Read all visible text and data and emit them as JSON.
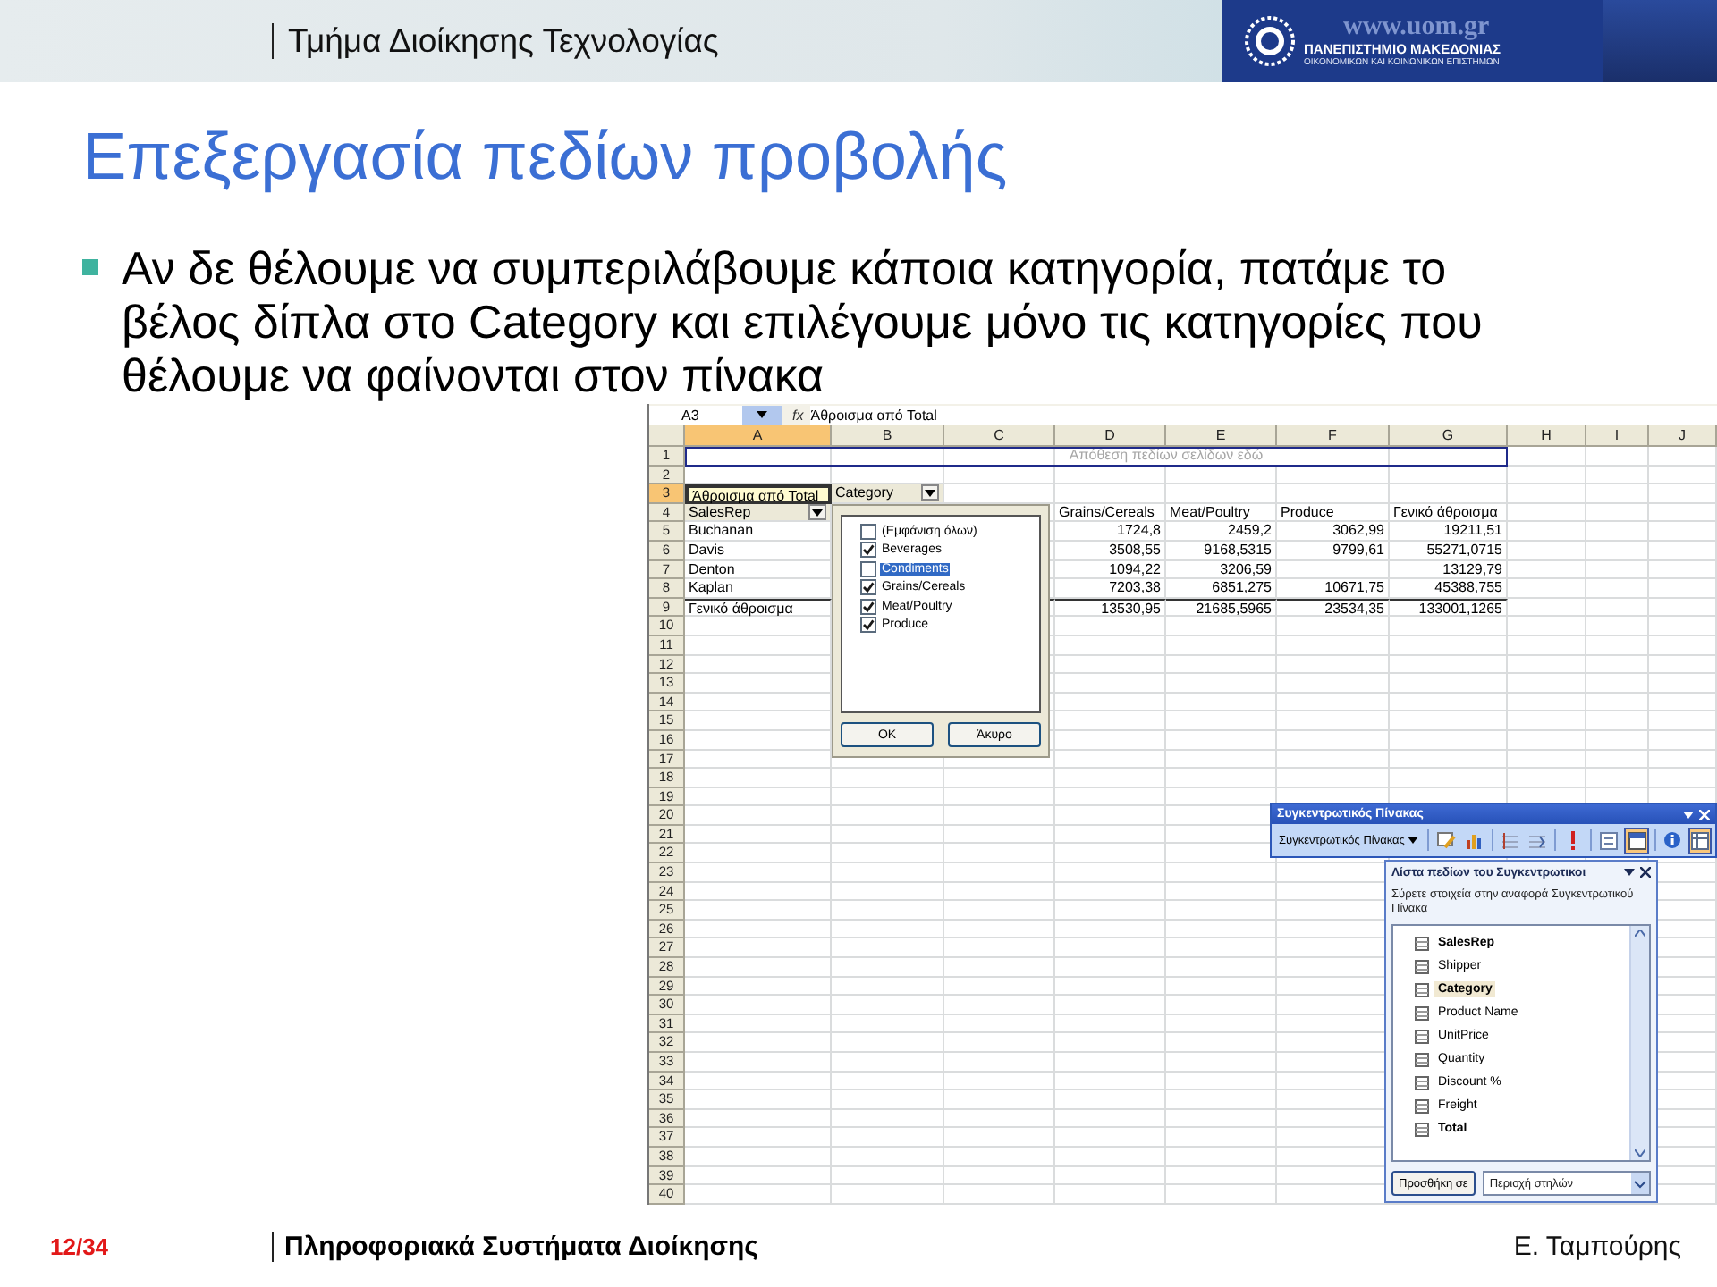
{
  "header": {
    "department": "Τμήμα Διοίκησης Τεχνολογίας",
    "logo": {
      "url": "www.uom.gr",
      "name": "ΠΑΝΕΠΙΣΤΗΜΙΟ ΜΑΚΕΔΟΝΙΑΣ",
      "subtitle": "ΟΙΚΟΝΟΜΙΚΩΝ ΚΑΙ ΚΟΙΝΩΝΙΚΩΝ ΕΠΙΣΤΗΜΩΝ"
    }
  },
  "title": "Επεξεργασία πεδίων προβολής",
  "bullets": [
    "Αν δε θέλουμε να συμπεριλάβουμε κάποια κατηγορία, πατάμε το βέλος δίπλα στο Category και επιλέγουμε μόνο τις κατηγορίες που θέλουμε να φαίνονται στον πίνακα"
  ],
  "spreadsheet": {
    "name_box": "A3",
    "function_label": "fx",
    "formula": "Άθροισμα από Total",
    "columns": [
      {
        "label": "A",
        "selected": true
      },
      {
        "label": "B",
        "selected": false
      },
      {
        "label": "C",
        "selected": false
      },
      {
        "label": "D",
        "selected": false
      },
      {
        "label": "E",
        "selected": false
      },
      {
        "label": "F",
        "selected": false
      },
      {
        "label": "G",
        "selected": false
      },
      {
        "label": "H",
        "selected": false
      },
      {
        "label": "I",
        "selected": false
      },
      {
        "label": "J",
        "selected": false
      }
    ],
    "rows": [
      {
        "number": "1",
        "selected": false,
        "cells": [
          {
            "text": "",
            "kind": "label"
          },
          {
            "text": "",
            "kind": "label"
          },
          {
            "text": "",
            "kind": "label"
          },
          {
            "text": "Απόθεση πεδίων σελίδων εδώ",
            "kind": "drop_zone"
          }
        ]
      },
      {
        "number": "2",
        "selected": false,
        "cells": []
      },
      {
        "number": "3",
        "selected": true,
        "cells": [
          {
            "text": "Άθροισμα από Total",
            "kind": "data_field"
          },
          {
            "text": "Category",
            "kind": "field_button"
          }
        ]
      },
      {
        "number": "4",
        "selected": false,
        "cells": [
          {
            "text": "SalesRep",
            "kind": "field_button"
          },
          {
            "text": "",
            "kind": "label"
          },
          {
            "text": "",
            "kind": "label"
          },
          {
            "text": "Grains/Cereals",
            "kind": "label"
          },
          {
            "text": "Meat/Poultry",
            "kind": "label"
          },
          {
            "text": "Produce",
            "kind": "label"
          },
          {
            "text": "Γενικό άθροισμα",
            "kind": "label"
          }
        ]
      },
      {
        "number": "5",
        "selected": false,
        "cells": [
          {
            "text": "Buchanan",
            "kind": "label"
          },
          {
            "text": "",
            "kind": "number"
          },
          {
            "text": "",
            "kind": "number"
          },
          {
            "text": "1724,8",
            "kind": "number"
          },
          {
            "text": "2459,2",
            "kind": "number"
          },
          {
            "text": "3062,99",
            "kind": "number"
          },
          {
            "text": "19211,51",
            "kind": "number"
          }
        ]
      },
      {
        "number": "6",
        "selected": false,
        "cells": [
          {
            "text": "Davis",
            "kind": "label"
          },
          {
            "text": "",
            "kind": "number"
          },
          {
            "text": "",
            "kind": "number"
          },
          {
            "text": "3508,55",
            "kind": "number"
          },
          {
            "text": "9168,5315",
            "kind": "number"
          },
          {
            "text": "9799,61",
            "kind": "number"
          },
          {
            "text": "55271,0715",
            "kind": "number"
          }
        ]
      },
      {
        "number": "7",
        "selected": false,
        "cells": [
          {
            "text": "Denton",
            "kind": "label"
          },
          {
            "text": "",
            "kind": "number"
          },
          {
            "text": "",
            "kind": "number"
          },
          {
            "text": "1094,22",
            "kind": "number"
          },
          {
            "text": "3206,59",
            "kind": "number"
          },
          {
            "text": "",
            "kind": "number"
          },
          {
            "text": "13129,79",
            "kind": "number"
          }
        ]
      },
      {
        "number": "8",
        "selected": false,
        "cells": [
          {
            "text": "Kaplan",
            "kind": "label"
          },
          {
            "text": "",
            "kind": "number"
          },
          {
            "text": "",
            "kind": "number"
          },
          {
            "text": "7203,38",
            "kind": "number"
          },
          {
            "text": "6851,275",
            "kind": "number"
          },
          {
            "text": "10671,75",
            "kind": "number"
          },
          {
            "text": "45388,755",
            "kind": "number"
          }
        ]
      },
      {
        "number": "9",
        "selected": false,
        "cells": [
          {
            "text": "Γενικό άθροισμα",
            "kind": "total_label"
          },
          {
            "text": "",
            "kind": "total_number"
          },
          {
            "text": "",
            "kind": "total_number"
          },
          {
            "text": "13530,95",
            "kind": "total_number"
          },
          {
            "text": "21685,5965",
            "kind": "total_number"
          },
          {
            "text": "23534,35",
            "kind": "total_number"
          },
          {
            "text": "133001,1265",
            "kind": "total_number"
          }
        ]
      },
      {
        "number": "10",
        "selected": false,
        "cells": []
      },
      {
        "number": "11",
        "selected": false,
        "cells": []
      },
      {
        "number": "12",
        "selected": false,
        "cells": []
      },
      {
        "number": "13",
        "selected": false,
        "cells": []
      },
      {
        "number": "14",
        "selected": false,
        "cells": []
      },
      {
        "number": "15",
        "selected": false,
        "cells": []
      },
      {
        "number": "16",
        "selected": false,
        "cells": []
      },
      {
        "number": "17",
        "selected": false,
        "cells": []
      },
      {
        "number": "18",
        "selected": false,
        "cells": []
      },
      {
        "number": "19",
        "selected": false,
        "cells": []
      },
      {
        "number": "20",
        "selected": false,
        "cells": []
      },
      {
        "number": "21",
        "selected": false,
        "cells": []
      },
      {
        "number": "22",
        "selected": false,
        "cells": []
      },
      {
        "number": "23",
        "selected": false,
        "cells": []
      },
      {
        "number": "24",
        "selected": false,
        "cells": []
      },
      {
        "number": "25",
        "selected": false,
        "cells": []
      },
      {
        "number": "26",
        "selected": false,
        "cells": []
      },
      {
        "number": "27",
        "selected": false,
        "cells": []
      },
      {
        "number": "28",
        "selected": false,
        "cells": []
      },
      {
        "number": "29",
        "selected": false,
        "cells": []
      },
      {
        "number": "30",
        "selected": false,
        "cells": []
      },
      {
        "number": "31",
        "selected": false,
        "cells": []
      },
      {
        "number": "32",
        "selected": false,
        "cells": []
      },
      {
        "number": "33",
        "selected": false,
        "cells": []
      },
      {
        "number": "34",
        "selected": false,
        "cells": []
      },
      {
        "number": "35",
        "selected": false,
        "cells": []
      },
      {
        "number": "36",
        "selected": false,
        "cells": []
      },
      {
        "number": "37",
        "selected": false,
        "cells": []
      },
      {
        "number": "38",
        "selected": false,
        "cells": []
      },
      {
        "number": "39",
        "selected": false,
        "cells": []
      },
      {
        "number": "40",
        "selected": false,
        "cells": []
      }
    ],
    "filter_popup": {
      "items": [
        {
          "label": "(Εμφάνιση όλων)",
          "checked": false,
          "selected": false
        },
        {
          "label": "Beverages",
          "checked": true,
          "selected": false
        },
        {
          "label": "Condiments",
          "checked": false,
          "selected": true
        },
        {
          "label": "Grains/Cereals",
          "checked": true,
          "selected": false
        },
        {
          "label": "Meat/Poultry",
          "checked": true,
          "selected": false
        },
        {
          "label": "Produce",
          "checked": true,
          "selected": false
        }
      ],
      "buttons": [
        "OK",
        "Άκυρο"
      ]
    },
    "pivot_toolbar": {
      "title": "Συγκεντρωτικός Πίνακας",
      "menu": "Συγκεντρωτικός Πίνακας",
      "buttons": [
        {
          "kind": "format",
          "pressed": false,
          "separator_before": true
        },
        {
          "kind": "chart",
          "pressed": false,
          "separator_before": false
        },
        {
          "kind": "hide_detail",
          "pressed": false,
          "separator_before": true
        },
        {
          "kind": "show_detail",
          "pressed": false,
          "separator_before": false
        },
        {
          "kind": "refresh",
          "pressed": false,
          "separator_before": true
        },
        {
          "kind": "settings",
          "pressed": false,
          "separator_before": true
        },
        {
          "kind": "field_list",
          "pressed": true,
          "separator_before": false
        },
        {
          "kind": "properties",
          "pressed": false,
          "separator_before": true
        },
        {
          "kind": "table",
          "pressed": true,
          "separator_before": false
        }
      ]
    },
    "field_list": {
      "title": "Λίστα πεδίων του Συγκεντρωτικοι",
      "instruction": "Σύρετε στοιχεία στην αναφορά Συγκεντρωτικού Πίνακα",
      "fields": [
        {
          "label": "SalesRep",
          "in_use": true,
          "selected": false
        },
        {
          "label": "Shipper",
          "in_use": false,
          "selected": false
        },
        {
          "label": "Category",
          "in_use": true,
          "selected": true
        },
        {
          "label": "Product Name",
          "in_use": false,
          "selected": false
        },
        {
          "label": "UnitPrice",
          "in_use": false,
          "selected": false
        },
        {
          "label": "Quantity",
          "in_use": false,
          "selected": false
        },
        {
          "label": "Discount %",
          "in_use": false,
          "selected": false
        },
        {
          "label": "Freight",
          "in_use": false,
          "selected": false
        },
        {
          "label": "Total",
          "in_use": true,
          "selected": false
        }
      ],
      "add_button": "Προσθήκη σε",
      "area": "Περιοχή στηλών"
    }
  },
  "footer": {
    "page": "12/34",
    "course": "Πληροφοριακά Συστήματα Διοίκησης",
    "author": "Ε. Ταμπούρης"
  }
}
